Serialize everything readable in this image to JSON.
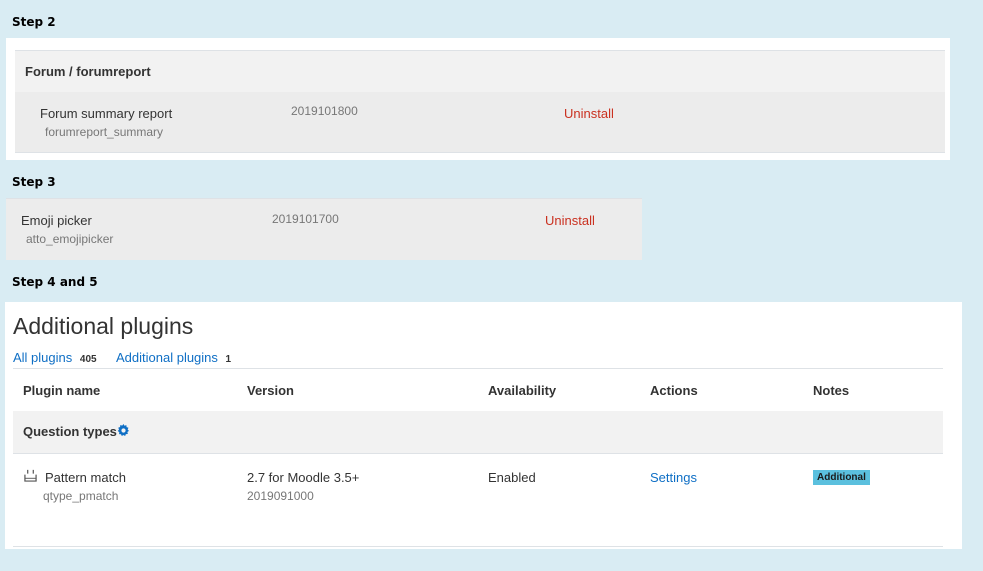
{
  "step2": {
    "label": "Step 2",
    "section_header": "Forum / forumreport",
    "plugin": {
      "name": "Forum summary report",
      "component": "forumreport_summary",
      "version": "2019101800",
      "action": "Uninstall"
    }
  },
  "step3": {
    "label": "Step 3",
    "plugin": {
      "name": "Emoji picker",
      "component": "atto_emojipicker",
      "version": "2019101700",
      "action": "Uninstall"
    }
  },
  "step45": {
    "label": "Step 4 and 5",
    "title": "Additional plugins",
    "filters": [
      {
        "label": "All plugins",
        "count": "405"
      },
      {
        "label": "Additional plugins",
        "count": "1"
      }
    ],
    "columns": [
      "Plugin name",
      "Version",
      "Availability",
      "Actions",
      "Notes"
    ],
    "category": {
      "label": "Question types",
      "icon": "gear-icon"
    },
    "row": {
      "icon": "plugin-icon",
      "name": "Pattern match",
      "component": "qtype_pmatch",
      "release": "2.7 for Moodle 3.5+",
      "version": "2019091000",
      "availability": "Enabled",
      "action": "Settings",
      "note": "Additional"
    }
  },
  "colors": {
    "background": "#d9ecf3",
    "link": "#0f6fc5",
    "uninstall": "#ca3120",
    "note_badge": "#5bc0de",
    "row_grey": "#ececec"
  }
}
